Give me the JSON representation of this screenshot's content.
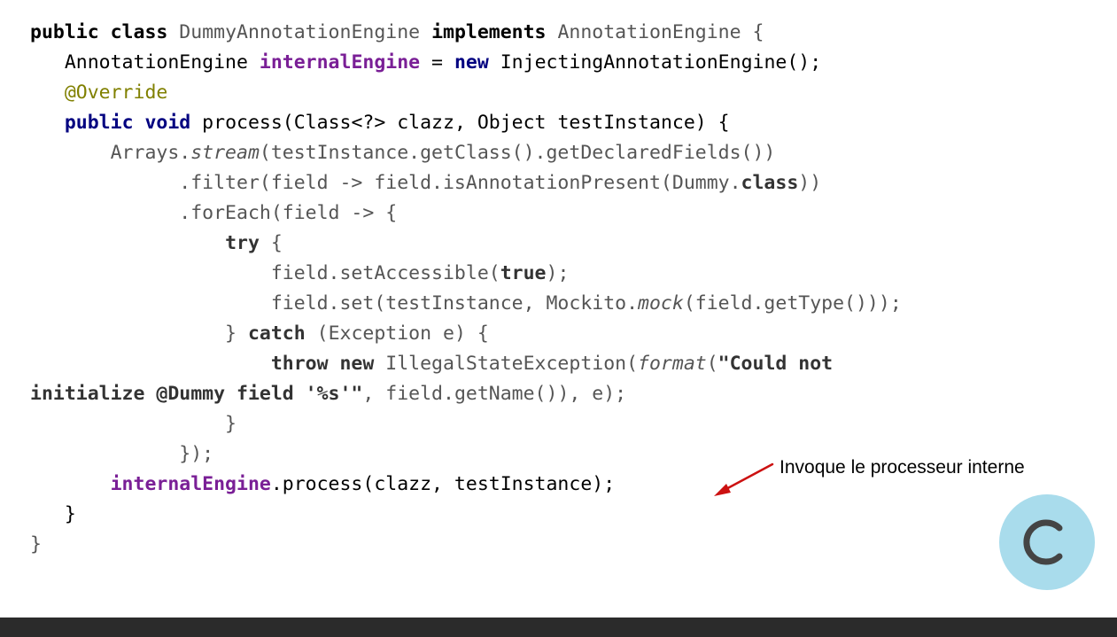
{
  "code": {
    "lines": [
      [
        {
          "t": "public class",
          "c": "kw"
        },
        {
          "t": " DummyAnnotationEngine ",
          "c": "",
          "color": "#555555"
        },
        {
          "t": "implements",
          "c": "kw"
        },
        {
          "t": " AnnotationEngine {",
          "c": "",
          "color": "#555555"
        }
      ],
      [
        {
          "t": "   AnnotationEngine ",
          "c": "",
          "color": "#000000"
        },
        {
          "t": "internalEngine",
          "c": "kw-purple"
        },
        {
          "t": " = ",
          "c": "",
          "color": "#000000"
        },
        {
          "t": "new",
          "c": "kw-navy"
        },
        {
          "t": " InjectingAnnotationEngine();",
          "c": "",
          "color": "#000000"
        }
      ],
      [
        {
          "t": "   @Override",
          "c": "ann"
        }
      ],
      [
        {
          "t": "   ",
          "c": ""
        },
        {
          "t": "public void",
          "c": "kw-navy"
        },
        {
          "t": " process(Class<?> clazz, Object testInstance) {",
          "c": "",
          "color": "#000000"
        }
      ],
      [
        {
          "t": "       Arrays.",
          "c": "",
          "color": "#555555"
        },
        {
          "t": "stream",
          "c": "it",
          "color": "#555555"
        },
        {
          "t": "(testInstance.getClass().getDeclaredFields())",
          "c": "",
          "color": "#555555"
        }
      ],
      [
        {
          "t": "             .filter(field -> field.isAnnotationPresent(Dummy.",
          "c": "",
          "color": "#555555"
        },
        {
          "t": "class",
          "c": "kw",
          "color": "#333333"
        },
        {
          "t": "))",
          "c": "",
          "color": "#555555"
        }
      ],
      [
        {
          "t": "             .forEach(field -> {",
          "c": "",
          "color": "#555555"
        }
      ],
      [
        {
          "t": "                 ",
          "c": ""
        },
        {
          "t": "try",
          "c": "kw",
          "color": "#333333"
        },
        {
          "t": " {",
          "c": "",
          "color": "#555555"
        }
      ],
      [
        {
          "t": "                     field.setAccessible(",
          "c": "",
          "color": "#555555"
        },
        {
          "t": "true",
          "c": "kw",
          "color": "#333333"
        },
        {
          "t": ");",
          "c": "",
          "color": "#555555"
        }
      ],
      [
        {
          "t": "                     field.set(testInstance, Mockito.",
          "c": "",
          "color": "#555555"
        },
        {
          "t": "mock",
          "c": "it",
          "color": "#555555"
        },
        {
          "t": "(field.getType()));",
          "c": "",
          "color": "#555555"
        }
      ],
      [
        {
          "t": "                 } ",
          "c": "",
          "color": "#555555"
        },
        {
          "t": "catch",
          "c": "kw",
          "color": "#333333"
        },
        {
          "t": " (Exception e) {",
          "c": "",
          "color": "#555555"
        }
      ],
      [
        {
          "t": "                     ",
          "c": ""
        },
        {
          "t": "throw new",
          "c": "kw",
          "color": "#333333"
        },
        {
          "t": " IllegalStateException(",
          "c": "",
          "color": "#555555"
        },
        {
          "t": "format",
          "c": "it",
          "color": "#555555"
        },
        {
          "t": "(",
          "c": "",
          "color": "#555555"
        },
        {
          "t": "\"Could not",
          "c": "str",
          "color": "#333333"
        }
      ],
      [
        {
          "t": "initialize @Dummy field '%s'\"",
          "c": "str",
          "color": "#333333"
        },
        {
          "t": ", field.getName()), e);",
          "c": "",
          "color": "#555555"
        }
      ],
      [
        {
          "t": "                 }",
          "c": "",
          "color": "#555555"
        }
      ],
      [
        {
          "t": "             });",
          "c": "",
          "color": "#555555"
        }
      ],
      [
        {
          "t": "       ",
          "c": ""
        },
        {
          "t": "internalEngine",
          "c": "kw-purple"
        },
        {
          "t": ".process(clazz, testInstance);",
          "c": "",
          "color": "#000000"
        }
      ],
      [
        {
          "t": "   }",
          "c": "",
          "color": "#000000"
        }
      ],
      [
        {
          "t": "}",
          "c": "",
          "color": "#555555"
        }
      ]
    ]
  },
  "annotation": {
    "text": "Invoque le processeur interne",
    "arrow_color": "#cc1111"
  },
  "logo": {
    "icon": "c-logo-icon",
    "circle_color": "#a9dcec",
    "letter_color": "#444444"
  },
  "bottom_bar": {
    "color": "#2b2b2b"
  }
}
